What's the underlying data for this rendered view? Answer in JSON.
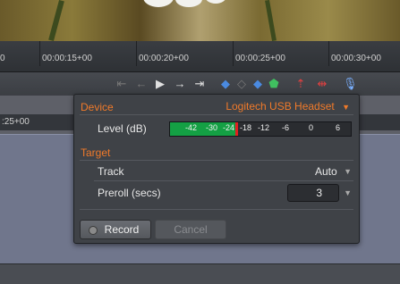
{
  "timeline": {
    "tick_labels": [
      "0",
      "00:00:15+00",
      "00:00:20+00",
      "00:00:25+00",
      "00:00:30+00"
    ],
    "track_time_label": ":25+00"
  },
  "toolbar": {
    "icons": [
      "skip-start-icon",
      "step-back-icon",
      "play-icon",
      "step-forward-icon",
      "skip-end-icon",
      "mark-in-icon",
      "marker-icon",
      "mark-out-icon",
      "clip-icon",
      "lift-icon",
      "extract-icon",
      "microphone-icon"
    ]
  },
  "record_panel": {
    "device_section": "Device",
    "device_value": "Logitech USB Headset",
    "level_label": "Level (dB)",
    "meter_labels": [
      "-42",
      "-30",
      "-24",
      "-18",
      "-12",
      "-6",
      "0",
      "6"
    ],
    "meter_level": 0.37,
    "target_section": "Target",
    "track_label": "Track",
    "track_value": "Auto",
    "preroll_label": "Preroll (secs)",
    "preroll_value": "3",
    "record_button": "Record",
    "cancel_button": "Cancel"
  },
  "colors": {
    "accent": "#f07a2a",
    "meter_green": "#14a044",
    "peak_red": "#e02020"
  }
}
